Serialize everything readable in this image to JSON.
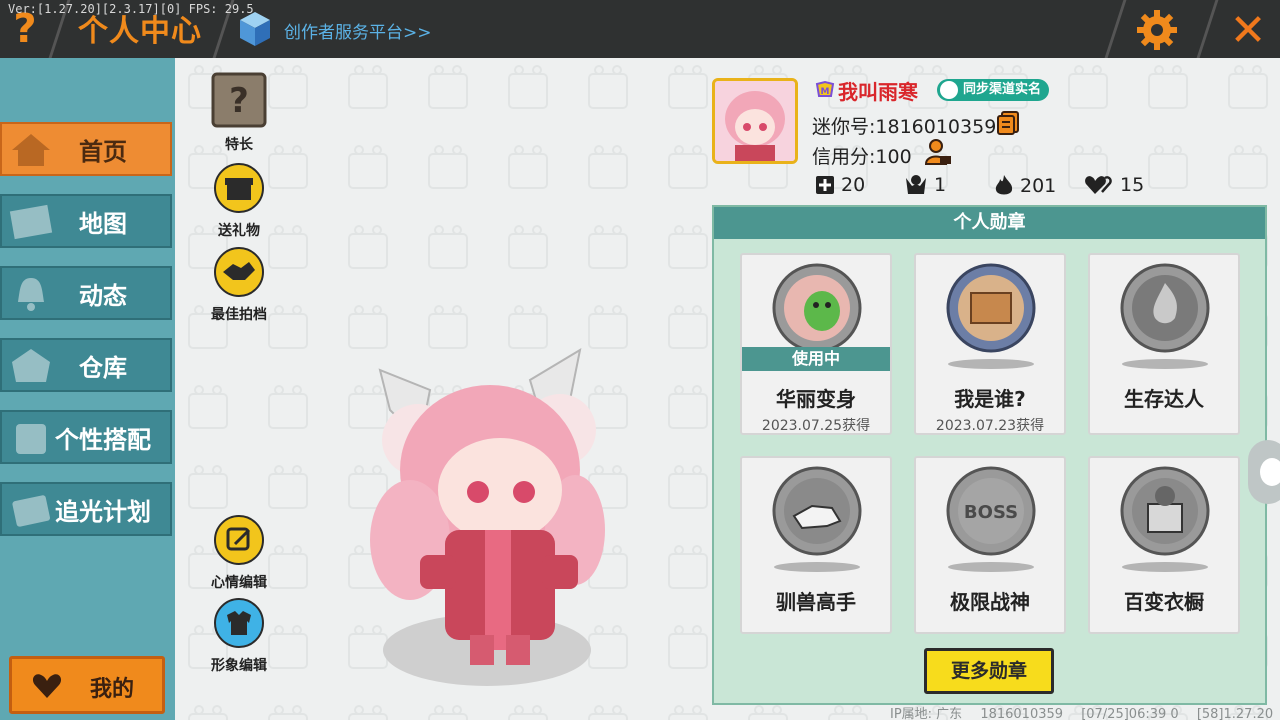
{
  "version": "Ver:[1.27.20][2.3.17][0] FPS: 29.5",
  "topbar": {
    "help_label": "?",
    "title": "个人中心",
    "creator_link": "创作者服务平台>>",
    "close_label": "✕"
  },
  "sidebar": {
    "items": [
      {
        "label": "首页",
        "icon": "house-icon",
        "active": true
      },
      {
        "label": "地图",
        "icon": "map-icon",
        "active": false
      },
      {
        "label": "动态",
        "icon": "bell-icon",
        "active": false
      },
      {
        "label": "仓库",
        "icon": "warehouse-icon",
        "active": false
      },
      {
        "label": "个性搭配",
        "icon": "outfit-icon",
        "active": false
      },
      {
        "label": "追光计划",
        "icon": "ticket-icon",
        "active": false
      }
    ],
    "mine_label": "我的"
  },
  "actions": {
    "specialty": "特长",
    "gift": "送礼物",
    "best_photo": "最佳拍档",
    "mood_edit": "心情编辑",
    "image_edit": "形象编辑"
  },
  "profile": {
    "nickname": "我叫雨寒",
    "realname_badge": "同步渠道实名",
    "mini_id": "迷你号:1816010359",
    "credit": "信用分:100",
    "stats": {
      "add": "20",
      "fans": "1",
      "fire": "201",
      "likes": "15"
    }
  },
  "medals": {
    "header": "个人勋章",
    "in_use_label": "使用中",
    "items": [
      {
        "name": "华丽变身",
        "date": "2023.07.25获得",
        "in_use": true
      },
      {
        "name": "我是谁?",
        "date": "2023.07.23获得",
        "in_use": false
      },
      {
        "name": "生存达人",
        "date": "",
        "in_use": false
      },
      {
        "name": "驯兽高手",
        "date": "",
        "in_use": false
      },
      {
        "name": "极限战神",
        "date": "",
        "in_use": false
      },
      {
        "name": "百变衣橱",
        "date": "",
        "in_use": false
      }
    ],
    "more_label": "更多勋章"
  },
  "footer": {
    "ip": "IP属地: 广东",
    "uid": "1816010359",
    "time": "[07/25]06:39 0",
    "build": "[58]1.27.20"
  },
  "colors": {
    "accent_orange": "#f08a1c",
    "teal": "#4c9690",
    "nickname_red": "#d9262b"
  }
}
